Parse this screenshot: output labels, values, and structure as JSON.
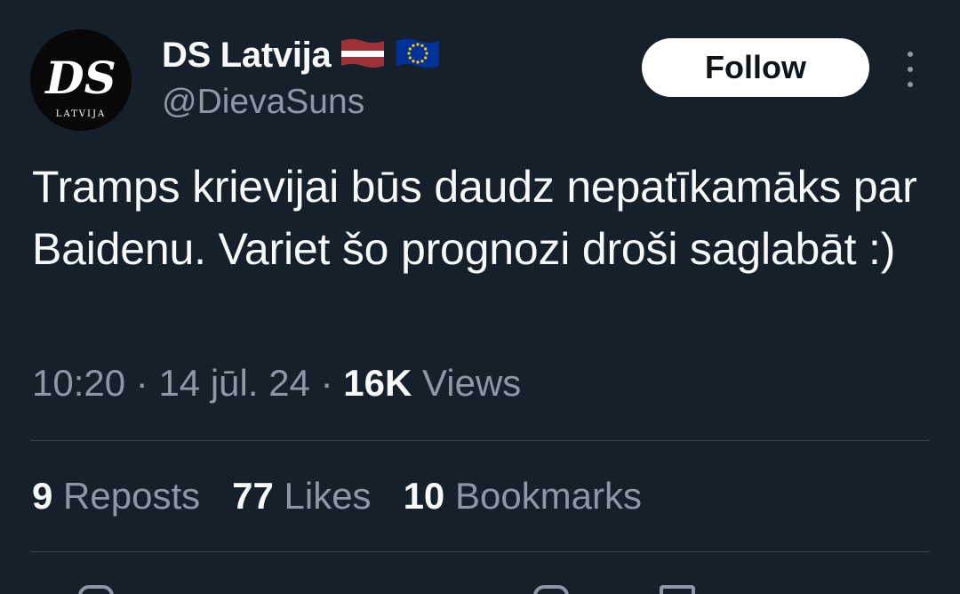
{
  "author": {
    "avatar_text": "DS",
    "avatar_subtext": "LATVIJA",
    "display_name": "DS Latvija",
    "flags": [
      "latvia-flag-icon",
      "eu-flag-icon"
    ],
    "handle": "@DievaSuns"
  },
  "follow_label": "Follow",
  "tweet": {
    "text": "Tramps krievijai būs daudz nepatīkamāks par Baidenu. Variet šo prognozi droši saglabāt :)",
    "time": "10:20",
    "date": "14 jūl. 24",
    "views_count": "16K",
    "views_label": "Views",
    "separator": "·"
  },
  "stats": {
    "reposts_count": "9",
    "reposts_label": "Reposts",
    "likes_count": "77",
    "likes_label": "Likes",
    "bookmarks_count": "10",
    "bookmarks_label": "Bookmarks"
  },
  "colors": {
    "background": "#15202b",
    "text_primary": "#f7f9f9",
    "text_secondary": "#8b98a5",
    "divider": "#38444d",
    "latvia_red": "#9e3039",
    "eu_blue": "#003399",
    "eu_star": "#ffcc00"
  }
}
